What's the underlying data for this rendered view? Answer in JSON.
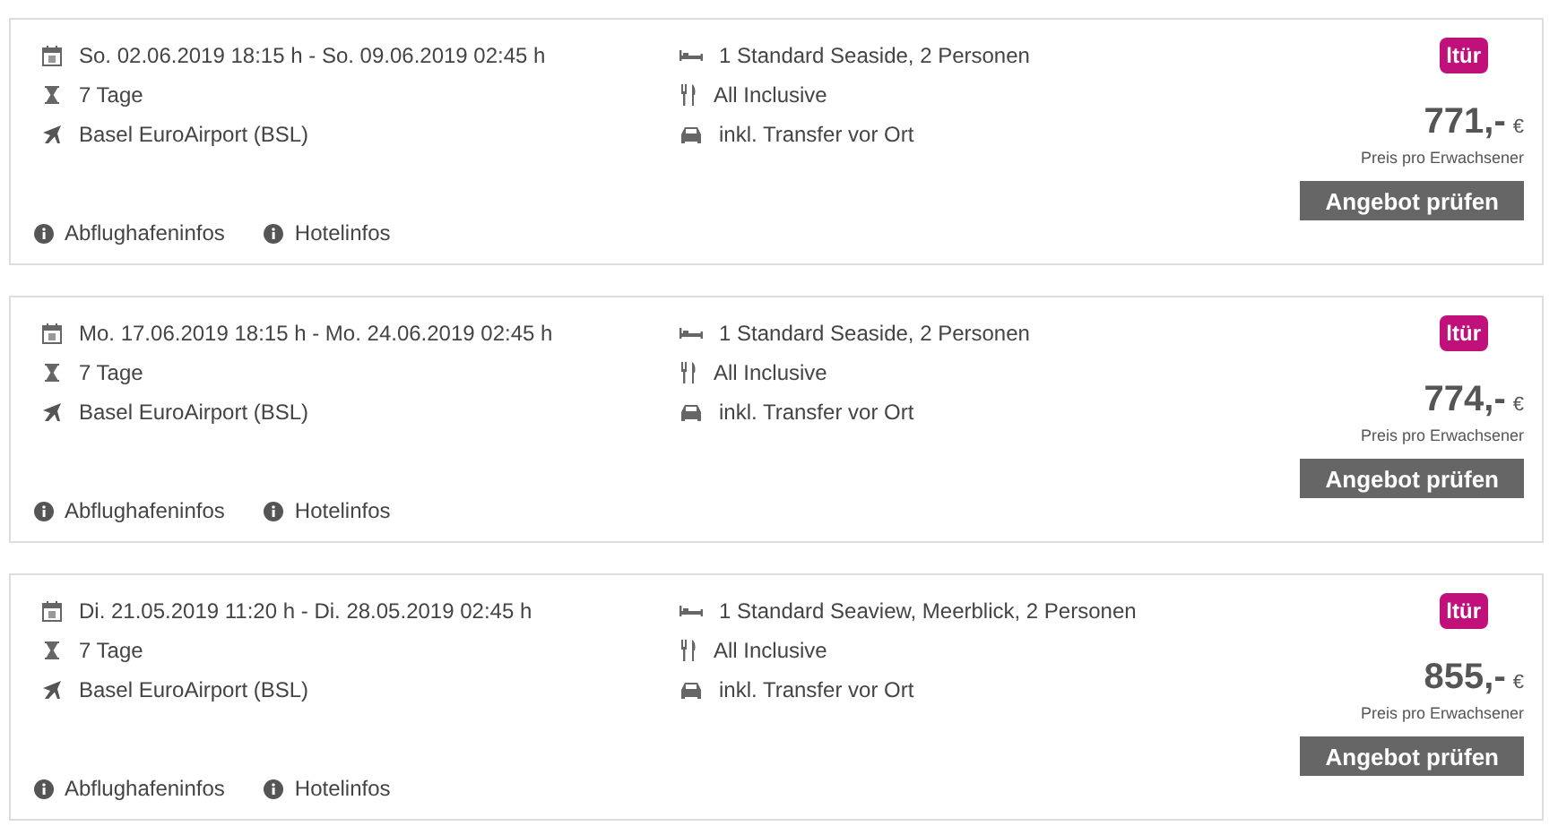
{
  "offers": [
    {
      "dates": "So. 02.06.2019 18:15 h - So. 09.06.2019 02:45 h",
      "duration": "7 Tage",
      "airport": "Basel EuroAirport (BSL)",
      "room": "1 Standard Seaside, 2 Personen",
      "board": "All Inclusive",
      "transfer": "inkl. Transfer vor Ort",
      "logo": "ltür",
      "price": "771,-",
      "currency": "€",
      "price_note": "Preis pro Erwachsener",
      "button": "Angebot prüfen",
      "links": [
        "Abflughafeninfos",
        "Hotelinfos"
      ]
    },
    {
      "dates": "Mo. 17.06.2019 18:15 h - Mo. 24.06.2019 02:45 h",
      "duration": "7 Tage",
      "airport": "Basel EuroAirport (BSL)",
      "room": "1 Standard Seaside, 2 Personen",
      "board": "All Inclusive",
      "transfer": "inkl. Transfer vor Ort",
      "logo": "ltür",
      "price": "774,-",
      "currency": "€",
      "price_note": "Preis pro Erwachsener",
      "button": "Angebot prüfen",
      "links": [
        "Abflughafeninfos",
        "Hotelinfos"
      ]
    },
    {
      "dates": "Di. 21.05.2019 11:20 h - Di. 28.05.2019 02:45 h",
      "duration": "7 Tage",
      "airport": "Basel EuroAirport (BSL)",
      "room": "1 Standard Seaview, Meerblick, 2 Personen",
      "board": "All Inclusive",
      "transfer": "inkl. Transfer vor Ort",
      "logo": "ltür",
      "price": "855,-",
      "currency": "€",
      "price_note": "Preis pro Erwachsener",
      "button": "Angebot prüfen",
      "links": [
        "Abflughafeninfos",
        "Hotelinfos"
      ]
    }
  ]
}
